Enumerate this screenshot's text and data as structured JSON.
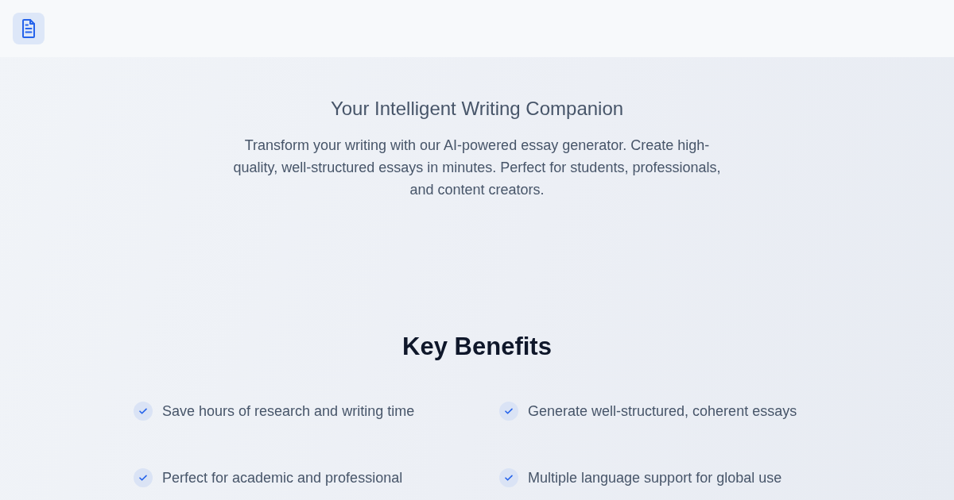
{
  "hero": {
    "title": "Your Intelligent Writing Companion",
    "description": "Transform your writing with our AI-powered essay generator. Create high-quality, well-structured essays in minutes. Perfect for students, professionals, and content creators."
  },
  "benefits": {
    "title": "Key Benefits",
    "items": [
      "Save hours of research and writing time",
      "Generate well-structured, coherent essays",
      "Perfect for academic and professional",
      "Multiple language support for global use"
    ]
  }
}
